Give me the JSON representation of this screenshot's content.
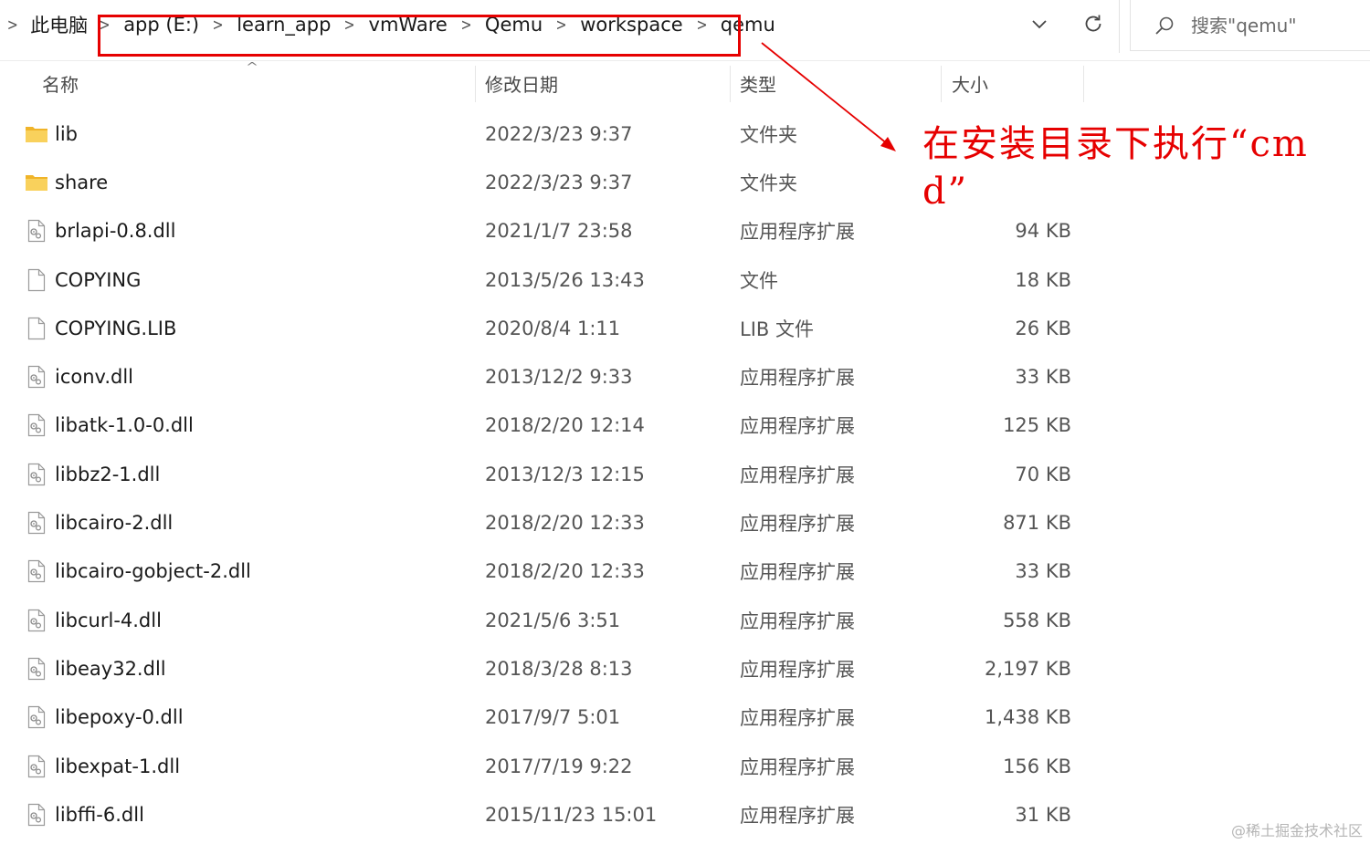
{
  "breadcrumb": {
    "items": [
      "此电脑",
      "app (E:)",
      "learn_app",
      "vmWare",
      "Qemu",
      "workspace",
      "qemu"
    ]
  },
  "search": {
    "placeholder": "搜索\"qemu\""
  },
  "columns": {
    "name": "名称",
    "date": "修改日期",
    "type": "类型",
    "size": "大小"
  },
  "files": [
    {
      "icon": "folder-icon",
      "name": "lib",
      "date": "2022/3/23 9:37",
      "type": "文件夹",
      "size": ""
    },
    {
      "icon": "folder-icon",
      "name": "share",
      "date": "2022/3/23 9:37",
      "type": "文件夹",
      "size": ""
    },
    {
      "icon": "dll-file-icon",
      "name": "brlapi-0.8.dll",
      "date": "2021/1/7 23:58",
      "type": "应用程序扩展",
      "size": "94 KB"
    },
    {
      "icon": "file-icon",
      "name": "COPYING",
      "date": "2013/5/26 13:43",
      "type": "文件",
      "size": "18 KB"
    },
    {
      "icon": "file-icon",
      "name": "COPYING.LIB",
      "date": "2020/8/4 1:11",
      "type": "LIB 文件",
      "size": "26 KB"
    },
    {
      "icon": "dll-file-icon",
      "name": "iconv.dll",
      "date": "2013/12/2 9:33",
      "type": "应用程序扩展",
      "size": "33 KB"
    },
    {
      "icon": "dll-file-icon",
      "name": "libatk-1.0-0.dll",
      "date": "2018/2/20 12:14",
      "type": "应用程序扩展",
      "size": "125 KB"
    },
    {
      "icon": "dll-file-icon",
      "name": "libbz2-1.dll",
      "date": "2013/12/3 12:15",
      "type": "应用程序扩展",
      "size": "70 KB"
    },
    {
      "icon": "dll-file-icon",
      "name": "libcairo-2.dll",
      "date": "2018/2/20 12:33",
      "type": "应用程序扩展",
      "size": "871 KB"
    },
    {
      "icon": "dll-file-icon",
      "name": "libcairo-gobject-2.dll",
      "date": "2018/2/20 12:33",
      "type": "应用程序扩展",
      "size": "33 KB"
    },
    {
      "icon": "dll-file-icon",
      "name": "libcurl-4.dll",
      "date": "2021/5/6 3:51",
      "type": "应用程序扩展",
      "size": "558 KB"
    },
    {
      "icon": "dll-file-icon",
      "name": "libeay32.dll",
      "date": "2018/3/28 8:13",
      "type": "应用程序扩展",
      "size": "2,197 KB"
    },
    {
      "icon": "dll-file-icon",
      "name": "libepoxy-0.dll",
      "date": "2017/9/7 5:01",
      "type": "应用程序扩展",
      "size": "1,438 KB"
    },
    {
      "icon": "dll-file-icon",
      "name": "libexpat-1.dll",
      "date": "2017/7/19 9:22",
      "type": "应用程序扩展",
      "size": "156 KB"
    },
    {
      "icon": "dll-file-icon",
      "name": "libffi-6.dll",
      "date": "2015/11/23 15:01",
      "type": "应用程序扩展",
      "size": "31 KB"
    }
  ],
  "annotation": {
    "text": "在安装目录下执行“cmd”"
  },
  "watermark": "@稀土掘金技术社区",
  "colors": {
    "annotation": "#e60000",
    "folder": "#f5c542",
    "text": "#1a1a1a",
    "secondary_text": "#555555"
  }
}
